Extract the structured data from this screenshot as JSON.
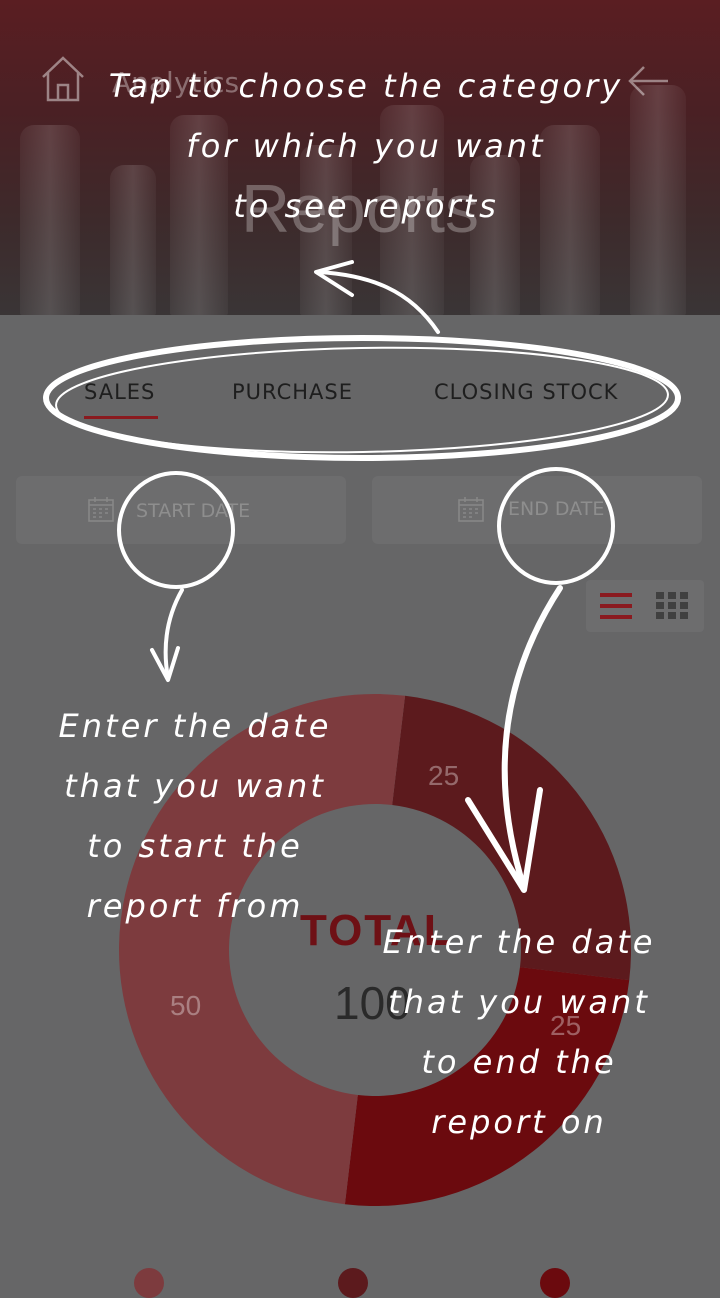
{
  "header": {
    "subtitle": "Analytics",
    "title": "Reports",
    "home_icon": "home-icon",
    "back_icon": "back-arrow-icon"
  },
  "tabs": [
    {
      "label": "SALES",
      "active": true
    },
    {
      "label": "PURCHASE",
      "active": false
    },
    {
      "label": "CLOSING STOCK",
      "active": false
    }
  ],
  "dates": {
    "start_placeholder": "START DATE",
    "end_placeholder": "END DATE",
    "icon": "calendar-icon"
  },
  "view_toggle": {
    "list_icon": "list-view-icon",
    "grid_icon": "grid-view-icon",
    "active": "list"
  },
  "colors": {
    "accent": "#8a1a1f",
    "segment_light": "#7d3b3e",
    "segment_dark": "#5c1a1d",
    "segment_red": "#6b0a0e"
  },
  "chart_data": {
    "type": "pie",
    "center_label": "TOTAL",
    "center_value": "100",
    "slices": [
      {
        "value": 25,
        "label": "25"
      },
      {
        "value": 25,
        "label": "25"
      },
      {
        "value": 50,
        "label": "50"
      }
    ]
  },
  "annotations": {
    "tabs_hint": [
      "Tap to choose the category",
      "for which you want",
      "to see reports"
    ],
    "start_hint": [
      "Enter the date",
      "that you want",
      "to start the",
      "report from"
    ],
    "end_hint": [
      "Enter the date",
      "that you want",
      "to end the",
      "report on"
    ]
  }
}
